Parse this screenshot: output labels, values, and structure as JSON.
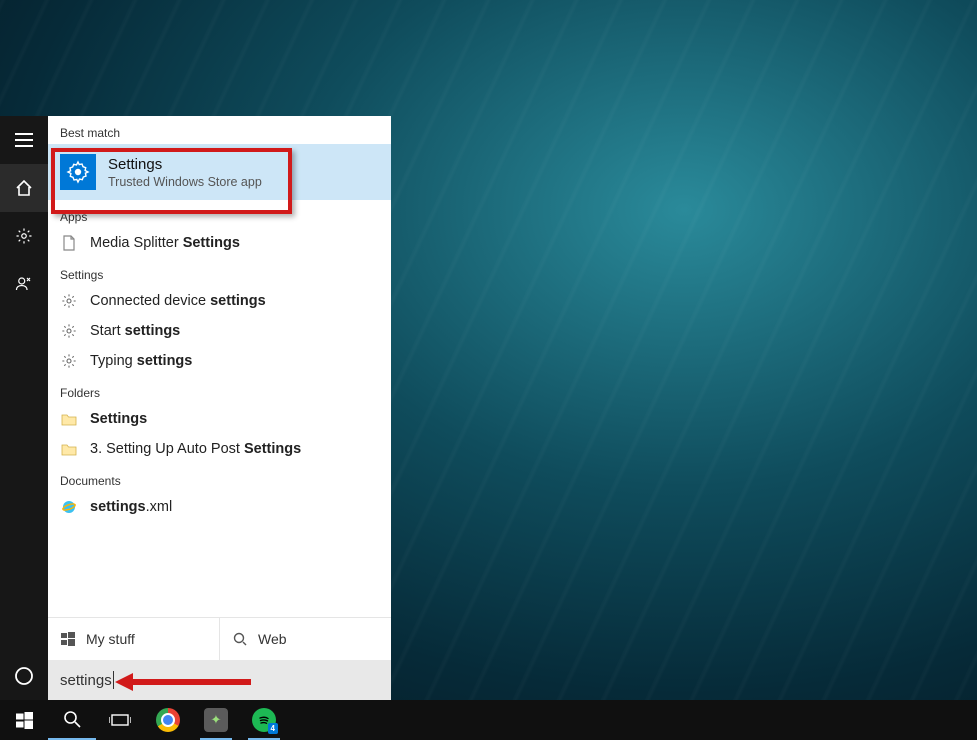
{
  "search": {
    "query": "settings",
    "tabs": {
      "mystuff": "My stuff",
      "web": "Web"
    }
  },
  "categories": {
    "best_match": "Best match",
    "apps": "Apps",
    "settings": "Settings",
    "folders": "Folders",
    "documents": "Documents"
  },
  "best": {
    "title": "Settings",
    "subtitle": "Trusted Windows Store app"
  },
  "apps_list": [
    {
      "pre": "Media Splitter ",
      "bold": "Settings"
    }
  ],
  "settings_list": [
    {
      "pre": "Connected device ",
      "bold": "settings"
    },
    {
      "pre": "Start ",
      "bold": "settings"
    },
    {
      "pre": "Typing ",
      "bold": "settings"
    }
  ],
  "folders_list": [
    {
      "pre": "",
      "bold": "Settings"
    },
    {
      "pre": "3. Setting Up Auto Post ",
      "bold": "Settings"
    }
  ],
  "documents_list": [
    {
      "pre": "",
      "bold": "settings",
      "post": ".xml"
    }
  ],
  "taskbar_apps": [
    "chrome",
    "evernote",
    "spotify"
  ],
  "spotify_badge": "4"
}
